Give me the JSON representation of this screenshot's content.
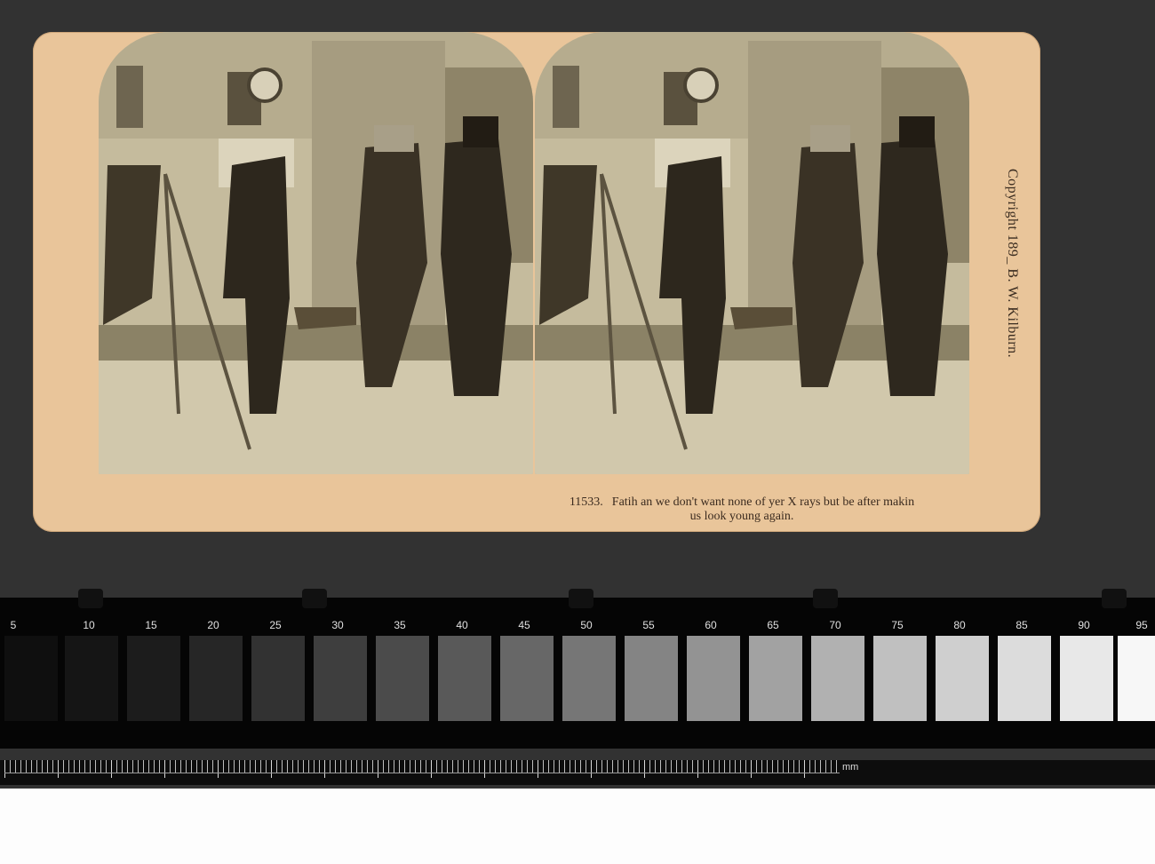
{
  "card": {
    "copyright": "Copyright 189_ B. W. Kilburn.",
    "caption_number": "11533.",
    "caption_line1": "Fatih an we don't want none of yer X rays but be after makin",
    "caption_line2": "us look young again."
  },
  "scale": {
    "labels": [
      "5",
      "10",
      "15",
      "20",
      "25",
      "30",
      "35",
      "40",
      "45",
      "50",
      "55",
      "60",
      "65",
      "70",
      "75",
      "80",
      "85",
      "90",
      "95"
    ],
    "unit": "mm"
  },
  "colors": {
    "card": "#e9c59a",
    "background": "#323232",
    "photo_tone": "#bfb596"
  }
}
